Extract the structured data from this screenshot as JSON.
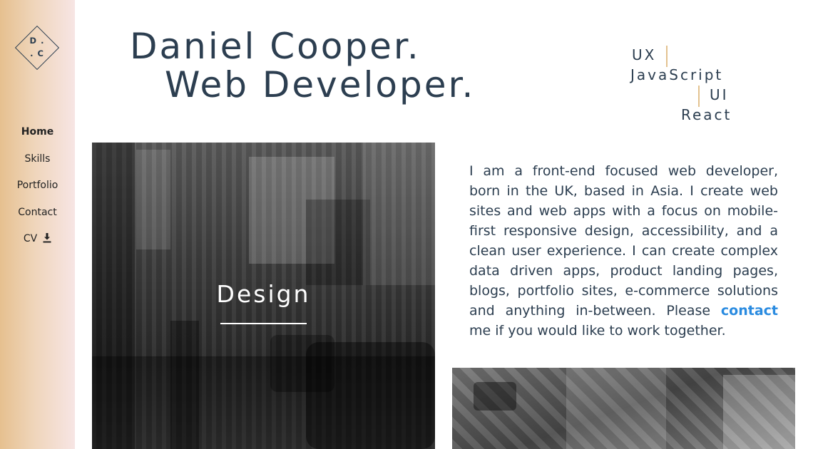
{
  "logo": {
    "line1": "D .",
    "line2": ". C"
  },
  "nav": {
    "items": [
      {
        "label": "Home",
        "active": true
      },
      {
        "label": "Skills"
      },
      {
        "label": "Portfolio"
      },
      {
        "label": "Contact"
      },
      {
        "label": "CV",
        "icon": "download-icon"
      }
    ]
  },
  "header": {
    "line1": "Daniel Cooper.",
    "line2": "Web Developer."
  },
  "skills": [
    "UX",
    "JavaScript",
    "UI",
    "React"
  ],
  "portfolio": {
    "design_label": "Design"
  },
  "bio": {
    "text_before": "I am a front-end focused web developer, born in the UK, based in Asia. I create web sites and web apps with a focus on mobile-first responsive design, accessibility, and a clean user experience. I can create complex data driven apps, product landing pages, blogs, portfolio sites, e-commerce solutions and anything in-between. Please ",
    "link": "contact",
    "text_after": " me if you would like to work together."
  },
  "colors": {
    "primary_text": "#2c3e50",
    "link": "#2a8be0",
    "accent_bar": "#e3c290",
    "sidebar_start": "#e6c08f",
    "sidebar_end": "#f7e5e4"
  }
}
